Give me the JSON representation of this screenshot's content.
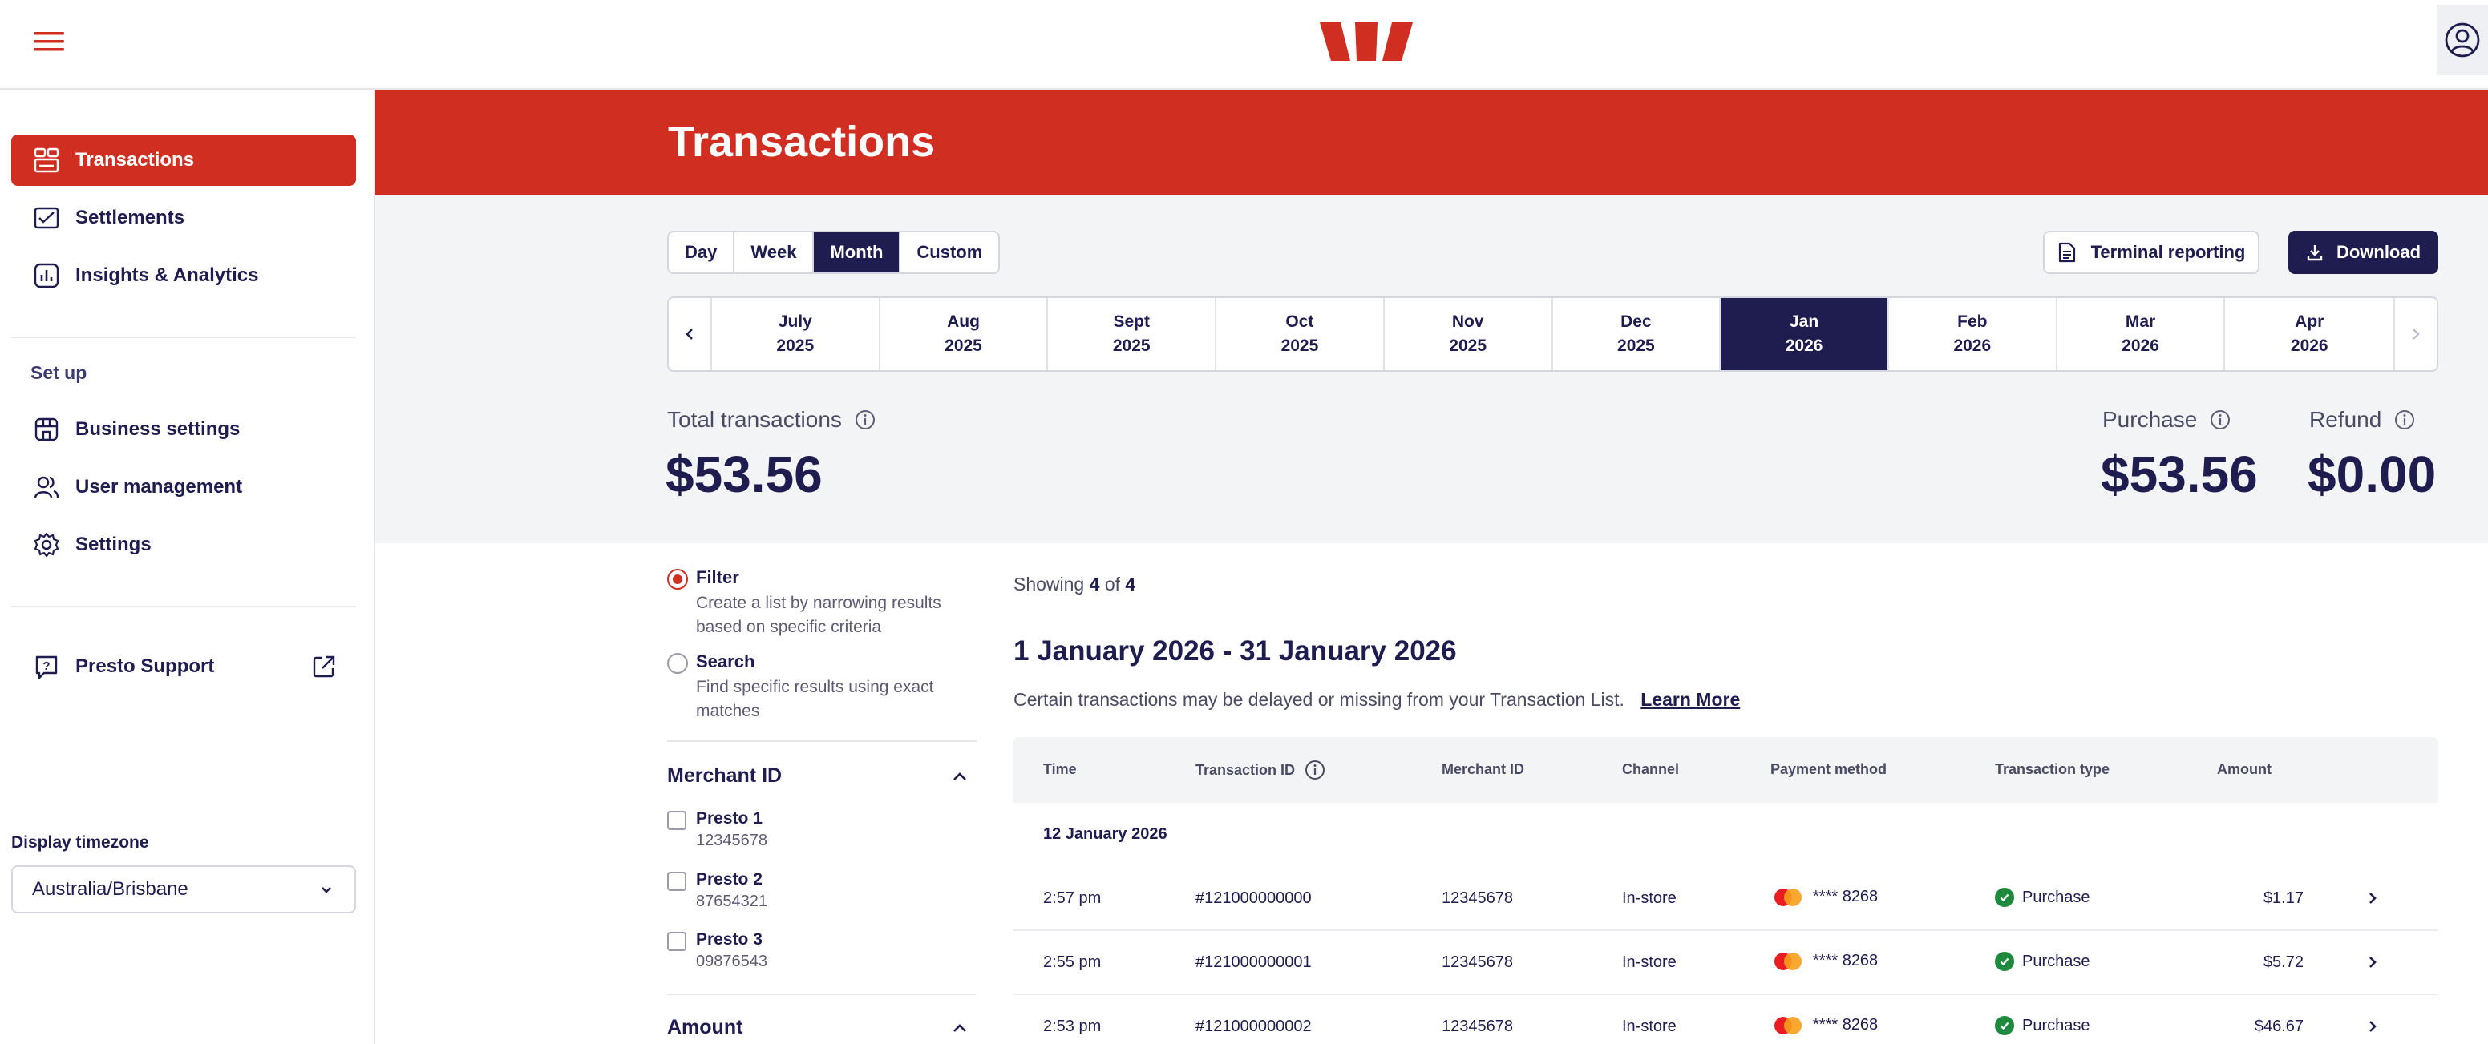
{
  "header": {
    "menu_icon": "hamburger-menu-icon",
    "logo": "westpac-logo",
    "profile_icon": "user-circle-icon"
  },
  "sidebar": {
    "nav": [
      {
        "label": "Transactions",
        "icon": "transactions-icon",
        "active": true
      },
      {
        "label": "Settlements",
        "icon": "settlements-icon",
        "active": false
      },
      {
        "label": "Insights & Analytics",
        "icon": "analytics-icon",
        "active": false
      }
    ],
    "setup_heading": "Set up",
    "setup": [
      {
        "label": "Business settings",
        "icon": "store-icon"
      },
      {
        "label": "User management",
        "icon": "users-icon"
      },
      {
        "label": "Settings",
        "icon": "gear-icon"
      }
    ],
    "support": {
      "label": "Presto Support",
      "icon": "help-icon"
    },
    "timezone_label": "Display timezone",
    "timezone_value": "Australia/Brisbane"
  },
  "page": {
    "title": "Transactions",
    "period_tabs": [
      "Day",
      "Week",
      "Month",
      "Custom"
    ],
    "active_period": "Month",
    "terminal_reporting": "Terminal reporting",
    "download": "Download",
    "months": [
      {
        "m": "July",
        "y": "2025"
      },
      {
        "m": "Aug",
        "y": "2025"
      },
      {
        "m": "Sept",
        "y": "2025"
      },
      {
        "m": "Oct",
        "y": "2025"
      },
      {
        "m": "Nov",
        "y": "2025"
      },
      {
        "m": "Dec",
        "y": "2025"
      },
      {
        "m": "Jan",
        "y": "2026"
      },
      {
        "m": "Feb",
        "y": "2026"
      },
      {
        "m": "Mar",
        "y": "2026"
      },
      {
        "m": "Apr",
        "y": "2026"
      }
    ],
    "active_month_index": 6,
    "totals": {
      "total_label": "Total transactions",
      "total_value": "$53.56",
      "purchase_label": "Purchase",
      "purchase_value": "$53.56",
      "refund_label": "Refund",
      "refund_value": "$0.00"
    }
  },
  "filters": {
    "filter_title": "Filter",
    "filter_desc": "Create a list by narrowing results based on specific criteria",
    "search_title": "Search",
    "search_desc": "Find specific results using exact matches",
    "merchant_heading": "Merchant ID",
    "merchants": [
      {
        "name": "Presto 1",
        "id": "12345678"
      },
      {
        "name": "Presto 2",
        "id": "87654321"
      },
      {
        "name": "Presto 3",
        "id": "09876543"
      }
    ],
    "amount_heading": "Amount"
  },
  "results": {
    "showing_prefix": "Showing",
    "showing_count": "4",
    "showing_of": "of",
    "showing_total": "4",
    "range_title": "1 January 2026 - 31 January 2026",
    "note": "Certain transactions may be delayed or missing from your Transaction List.",
    "learn_more": "Learn More",
    "columns": [
      "Time",
      "Transaction ID",
      "Merchant ID",
      "Channel",
      "Payment method",
      "Transaction type",
      "Amount"
    ],
    "date_group": "12 January 2026",
    "rows": [
      {
        "time": "2:57 pm",
        "txn": "#121000000000",
        "merchant": "12345678",
        "channel": "In-store",
        "card": "**** 8268",
        "type": "Purchase",
        "amount": "$1.17"
      },
      {
        "time": "2:55 pm",
        "txn": "#121000000001",
        "merchant": "12345678",
        "channel": "In-store",
        "card": "**** 8268",
        "type": "Purchase",
        "amount": "$5.72"
      },
      {
        "time": "2:53 pm",
        "txn": "#121000000002",
        "merchant": "12345678",
        "channel": "In-store",
        "card": "**** 8268",
        "type": "Purchase",
        "amount": "$46.67"
      }
    ]
  },
  "colors": {
    "brand_red": "#d12e22",
    "navy": "#1f1c4f",
    "success_green": "#1f8a3e"
  }
}
